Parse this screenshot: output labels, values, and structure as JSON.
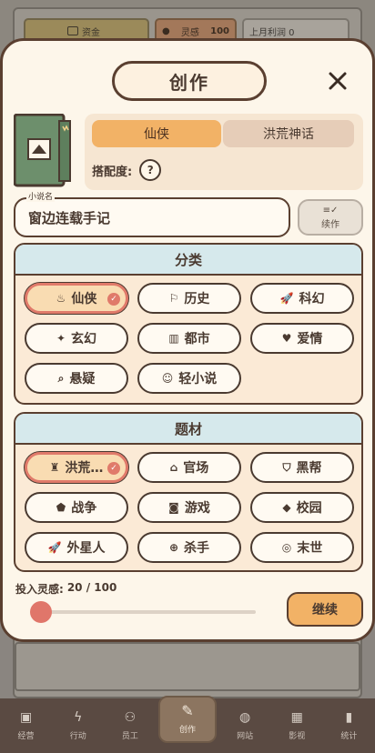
{
  "topbar": {
    "fund_label": "资金",
    "insp_label": "灵感",
    "insp_value": "100",
    "profit_label": "上月利润 0"
  },
  "modal": {
    "title": "创作",
    "genre_tabs": [
      {
        "label": "仙侠",
        "selected": true
      },
      {
        "label": "洪荒神话",
        "selected": false
      }
    ],
    "match_label": "搭配度:",
    "match_value": "?",
    "name_label": "小说名",
    "novel_name": "窗边连载手记",
    "series_label": "续作",
    "category": {
      "header": "分类",
      "items": [
        {
          "label": "仙侠",
          "icon": "♨",
          "selected": true
        },
        {
          "label": "历史",
          "icon": "⚐",
          "selected": false
        },
        {
          "label": "科幻",
          "icon": "🚀",
          "selected": false
        },
        {
          "label": "玄幻",
          "icon": "✦",
          "selected": false
        },
        {
          "label": "都市",
          "icon": "▥",
          "selected": false
        },
        {
          "label": "爱情",
          "icon": "♥",
          "selected": false
        },
        {
          "label": "悬疑",
          "icon": "⌕",
          "selected": false
        },
        {
          "label": "轻小说",
          "icon": "☺",
          "selected": false
        }
      ]
    },
    "theme": {
      "header": "题材",
      "items": [
        {
          "label": "洪荒…",
          "icon": "♜",
          "selected": true
        },
        {
          "label": "官场",
          "icon": "⌂",
          "selected": false
        },
        {
          "label": "黑帮",
          "icon": "⛉",
          "selected": false
        },
        {
          "label": "战争",
          "icon": "⬟",
          "selected": false
        },
        {
          "label": "游戏",
          "icon": "◙",
          "selected": false
        },
        {
          "label": "校园",
          "icon": "◆",
          "selected": false
        },
        {
          "label": "外星人",
          "icon": "🚀",
          "selected": false
        },
        {
          "label": "杀手",
          "icon": "⊕",
          "selected": false
        },
        {
          "label": "末世",
          "icon": "◎",
          "selected": false
        }
      ]
    },
    "inspiration_label": "投入灵感:",
    "inspiration_value": "20 / 100",
    "inspiration_fraction": 0.2,
    "continue_label": "继续"
  },
  "nav": [
    {
      "label": "经营",
      "icon": "briefcase-icon"
    },
    {
      "label": "行动",
      "icon": "bolt-icon"
    },
    {
      "label": "员工",
      "icon": "people-icon"
    },
    {
      "label": "创作",
      "icon": "pen-icon",
      "active": true
    },
    {
      "label": "网站",
      "icon": "globe-icon"
    },
    {
      "label": "影视",
      "icon": "film-icon"
    },
    {
      "label": "统计",
      "icon": "chart-icon"
    }
  ],
  "colors": {
    "accent": "#f2b266",
    "selected_border": "#e07a6a",
    "section_header": "#d6e9ec",
    "border": "#5a3f30"
  }
}
